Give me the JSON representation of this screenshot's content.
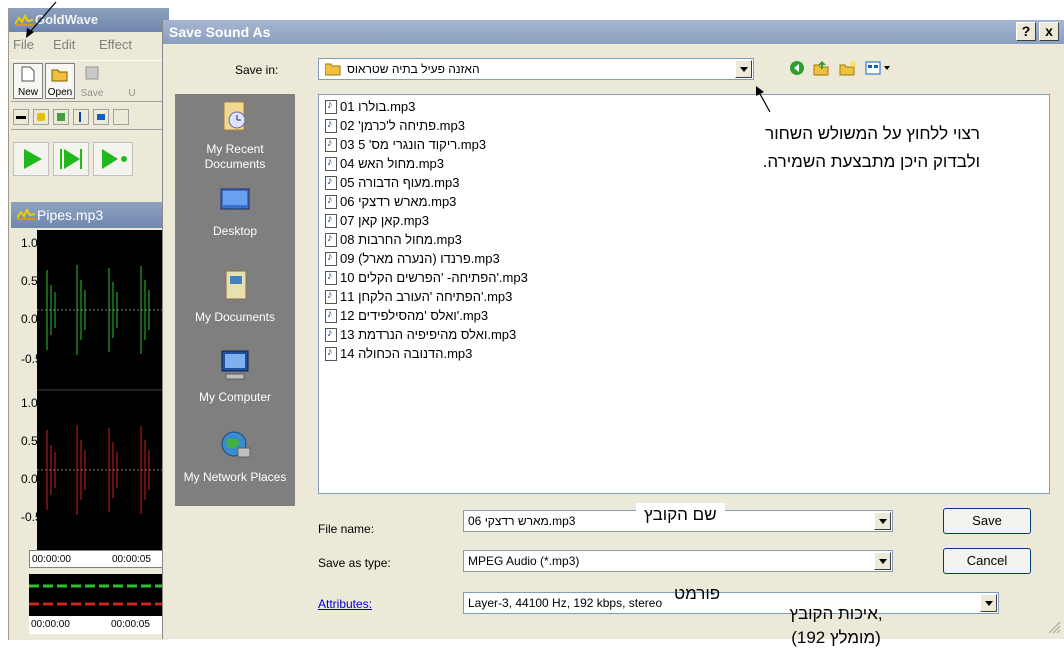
{
  "goldwave": {
    "title": "GoldWave",
    "menu": [
      "File",
      "Edit",
      "Effect"
    ],
    "toolbar": {
      "new": "New",
      "open": "Open",
      "save": "Save",
      "u": "U"
    },
    "document_title": "Pipes.mp3",
    "axis_labels": [
      "1.0",
      "0.5",
      "0.0",
      "-0.5",
      "1.0",
      "0.5",
      "0.0",
      "-0.5"
    ],
    "ruler_times": [
      "00:00:00",
      "00:00:05"
    ],
    "mini_times": [
      "00:00:00",
      "00:00:05"
    ]
  },
  "dialog": {
    "title": "Save Sound As",
    "help_button": "?",
    "close_button": "x",
    "save_in_label": "Save in:",
    "save_in_value": "האזנה פעיל בתיה שטראוס",
    "places": [
      "My Recent Documents",
      "Desktop",
      "My Documents",
      "My Computer",
      "My Network Places"
    ],
    "files": [
      "01 בולרו.mp3",
      "02 'פתיחה ל'כרמן.mp3",
      "03 ריקוד הונגרי מס' 5.mp3",
      "04 מחול האש.mp3",
      "05 מעוף הדבורה.mp3",
      "06 מארש רדצקי.mp3",
      "07 קאן קאן.mp3",
      "08 מחול החרבות.mp3",
      "09 פרנדו (הנערה מארל).mp3",
      "10 הפתיחה- 'הפרשים הקלים'.mp3",
      "11 הפתיחה 'העורב הלקחן'.mp3",
      "12 ואלס 'מהסילפידים'.mp3",
      "13 ואלס מהיפיפיה הנרדמת.mp3",
      "14 הדנובה הכחולה.mp3"
    ],
    "file_name_label": "File name:",
    "file_name_value": "06 מארש רדצקי.mp3",
    "save_as_type_label": "Save as type:",
    "save_as_type_value": "MPEG Audio (*.mp3)",
    "attributes_label": "Attributes:",
    "attributes_value": "Layer-3, 44100 Hz, 192 kbps, stereo",
    "save_button": "Save",
    "cancel_button": "Cancel"
  },
  "annotations": {
    "arrow_note": "רצוי ללחוץ על המשולש השחור ולבדוק היכן מתבצעת השמירה.",
    "file_name_note": "שם הקובץ",
    "format_note": "פורמט",
    "quality_note_line1": "איכות הקובץ,",
    "quality_note_line2": "(מומלץ 192)"
  },
  "colors": {
    "titlebar": "#8a9fc0",
    "places_panel": "#7f7f7f",
    "wave_green": "#2fbf2f",
    "wave_red": "#d02020",
    "play_green": "#1fb81f"
  }
}
